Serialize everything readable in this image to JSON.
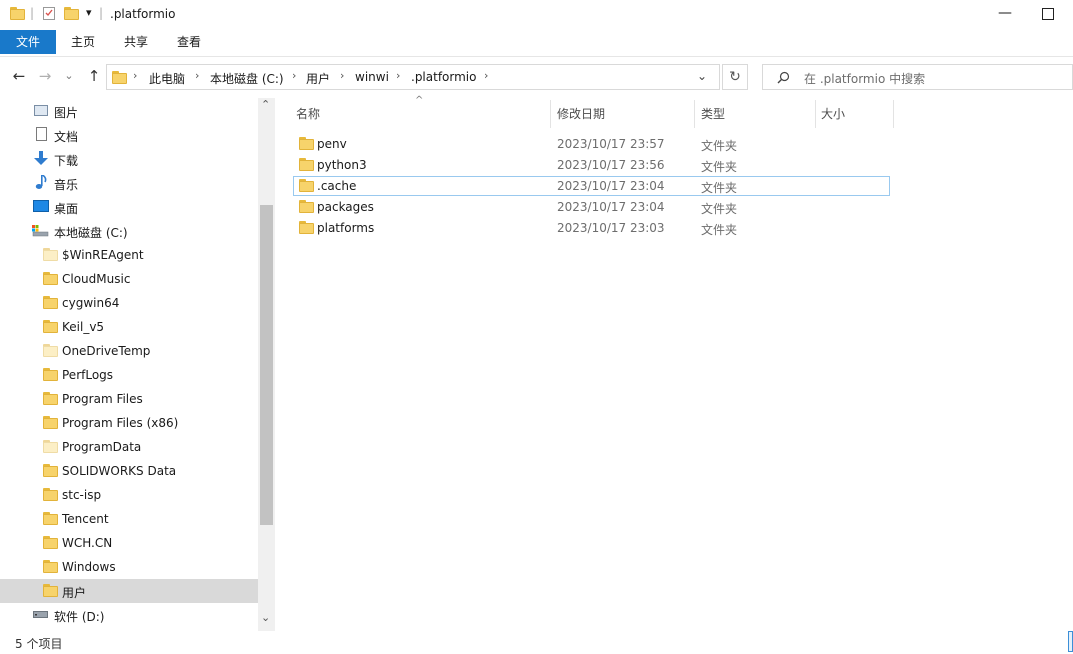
{
  "window": {
    "title": ".platformio",
    "qa_separator": "|",
    "qa_dropdown": "▾",
    "minimize_icon": "—"
  },
  "ribbon": {
    "tabs": [
      "文件",
      "主页",
      "共享",
      "查看"
    ],
    "active_tab_color": "#1979ca"
  },
  "address": {
    "back_icon": "←",
    "forward_icon": "→",
    "recent_icon": "⌄",
    "up_icon": "↑",
    "breadcrumbs": [
      "此电脑",
      "本地磁盘 (C:)",
      "用户",
      "winwi",
      ".platformio"
    ],
    "separator": "›",
    "history_icon": "⌄",
    "refresh_icon": "↻",
    "search_placeholder": "在 .platformio 中搜索",
    "search_icon": "search-icon"
  },
  "nav_pane": {
    "items": [
      {
        "label": "图片",
        "icon": "pictures-icon"
      },
      {
        "label": "文档",
        "icon": "documents-icon"
      },
      {
        "label": "下载",
        "icon": "download-icon"
      },
      {
        "label": "音乐",
        "icon": "music-icon"
      },
      {
        "label": "桌面",
        "icon": "desktop-icon"
      },
      {
        "label": "本地磁盘 (C:)",
        "icon": "drive-c-icon"
      },
      {
        "label": "$WinREAgent",
        "icon": "folder-icon"
      },
      {
        "label": "CloudMusic",
        "icon": "folder-icon"
      },
      {
        "label": "cygwin64",
        "icon": "folder-icon"
      },
      {
        "label": "Keil_v5",
        "icon": "folder-icon"
      },
      {
        "label": "OneDriveTemp",
        "icon": "folder-icon"
      },
      {
        "label": "PerfLogs",
        "icon": "folder-icon"
      },
      {
        "label": "Program Files",
        "icon": "folder-icon"
      },
      {
        "label": "Program Files (x86)",
        "icon": "folder-icon"
      },
      {
        "label": "ProgramData",
        "icon": "folder-icon"
      },
      {
        "label": "SOLIDWORKS Data",
        "icon": "folder-icon"
      },
      {
        "label": "stc-isp",
        "icon": "folder-icon"
      },
      {
        "label": "Tencent",
        "icon": "folder-icon"
      },
      {
        "label": "WCH.CN",
        "icon": "folder-icon"
      },
      {
        "label": "Windows",
        "icon": "folder-icon"
      },
      {
        "label": "用户",
        "icon": "folder-icon"
      },
      {
        "label": "软件 (D:)",
        "icon": "drive-d-icon"
      }
    ],
    "selected": "用户",
    "scroll_up_icon": "⌃",
    "scroll_down_icon": "⌄"
  },
  "content": {
    "sort_icon": "^",
    "columns": [
      "名称",
      "修改日期",
      "类型",
      "大小"
    ],
    "rows": [
      {
        "name": "penv",
        "modified": "2023/10/17 23:57",
        "type": "文件夹"
      },
      {
        "name": "python3",
        "modified": "2023/10/17 23:56",
        "type": "文件夹"
      },
      {
        "name": ".cache",
        "modified": "2023/10/17 23:04",
        "type": "文件夹"
      },
      {
        "name": "packages",
        "modified": "2023/10/17 23:04",
        "type": "文件夹"
      },
      {
        "name": "platforms",
        "modified": "2023/10/17 23:03",
        "type": "文件夹"
      }
    ],
    "focused_row": ".cache"
  },
  "status": {
    "item_count": "5 个项目"
  }
}
